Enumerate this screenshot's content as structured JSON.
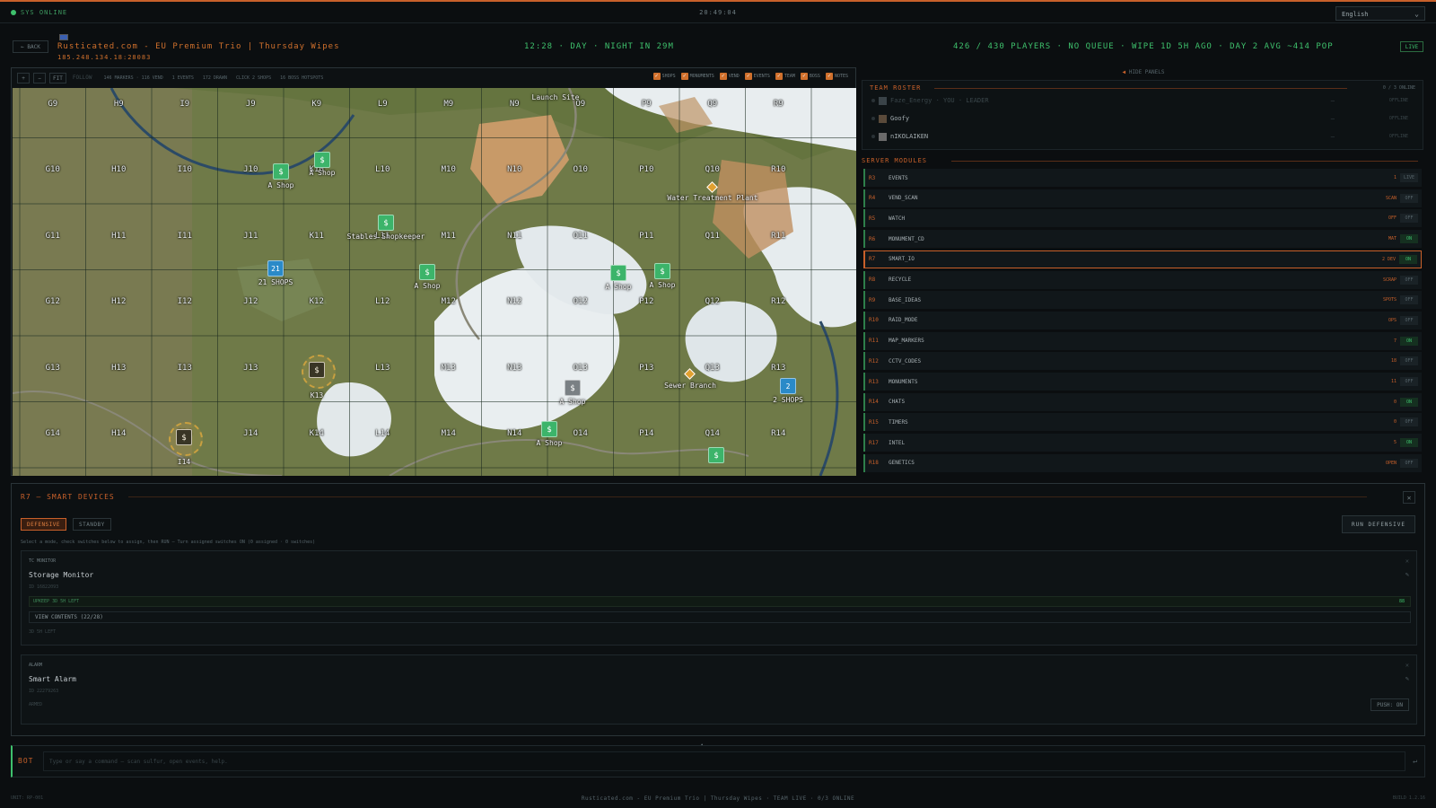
{
  "status": {
    "sys": "SYS ONLINE",
    "clock": "20:49:04",
    "language": "English"
  },
  "header": {
    "back": "← BACK",
    "server_name": "Rusticated.com - EU Premium Trio | Thursday Wipes",
    "server_ip": "185.248.134.18:28083",
    "daytime": "12:28 · DAY · NIGHT IN 29M",
    "players": "426 / 430 PLAYERS · NO QUEUE · WIPE 1D 5H AGO · DAY 2 AVG ~414 POP",
    "live": "LIVE"
  },
  "map": {
    "tools": [
      "+",
      "−",
      "FIT",
      "FOLLOW"
    ],
    "stats": [
      "146 MARKERS · 116 VEND",
      "1 EVENTS",
      "172 DRAWN",
      "CLICK 2 SHOPS",
      "16 BOSS HOTSPOTS"
    ],
    "filters": [
      "SHOPS",
      "MONUMENTS",
      "VEND",
      "EVENTS",
      "TEAM",
      "BOSS",
      "NOTES"
    ],
    "rows": [
      "9",
      "10",
      "11",
      "12",
      "13",
      "14"
    ],
    "cols": [
      "G",
      "H",
      "I",
      "J",
      "K",
      "L",
      "M",
      "N",
      "O",
      "P",
      "Q",
      "R"
    ],
    "labels": {
      "launch": "Launch Site",
      "water": "Water Treatment Plant",
      "stables": "Stables Shopkeeper",
      "sewer": "Sewer Branch",
      "shop": "A Shop",
      "shops21": "21 SHOPS",
      "shops2": "2 SHOPS",
      "k13": "K13",
      "i14": "I14"
    },
    "marker": {
      "dollar": "$",
      "n21": "21",
      "n2": "2"
    }
  },
  "roster": {
    "title": "TEAM ROSTER",
    "count": "0 / 3 ONLINE",
    "hide": "HIDE PANELS",
    "members": [
      {
        "name": "Faze_Energy · YOU · LEADER",
        "status": "OFFLINE"
      },
      {
        "name": "Goofy",
        "status": "OFFLINE"
      },
      {
        "name": "nIKOLAIKEN",
        "status": "OFFLINE"
      }
    ]
  },
  "modules": {
    "title": "SERVER MODULES",
    "items": [
      {
        "id": "R3",
        "name": "EVENTS",
        "val": "1",
        "tog": "LIVE"
      },
      {
        "id": "R4",
        "name": "VEND_SCAN",
        "val": "SCAN",
        "tog": "OFF"
      },
      {
        "id": "R5",
        "name": "WATCH",
        "val": "OFF",
        "tog": "OFF"
      },
      {
        "id": "R6",
        "name": "MONUMENT_CD",
        "val": "MAT",
        "tog": "ON"
      },
      {
        "id": "R7",
        "name": "SMART_IO",
        "val": "2 DEV",
        "tog": "ON"
      },
      {
        "id": "R8",
        "name": "RECYCLE",
        "val": "SCRAP",
        "tog": "OFF"
      },
      {
        "id": "R9",
        "name": "BASE_IDEAS",
        "val": "SPOTS",
        "tog": "OFF"
      },
      {
        "id": "R10",
        "name": "RAID_MODE",
        "val": "OPS",
        "tog": "OFF"
      },
      {
        "id": "R11",
        "name": "MAP_MARKERS",
        "val": "7",
        "tog": "ON"
      },
      {
        "id": "R12",
        "name": "CCTV_CODES",
        "val": "18",
        "tog": "OFF"
      },
      {
        "id": "R13",
        "name": "MONUMENTS",
        "val": "11",
        "tog": "OFF"
      },
      {
        "id": "R14",
        "name": "CHATS",
        "val": "0",
        "tog": "ON"
      },
      {
        "id": "R15",
        "name": "TIMERS",
        "val": "0",
        "tog": "OFF"
      },
      {
        "id": "R17",
        "name": "INTEL",
        "val": "5",
        "tog": "ON"
      },
      {
        "id": "R18",
        "name": "GENETICS",
        "val": "OPEN",
        "tog": "OFF"
      }
    ]
  },
  "devices": {
    "title": "R7 — SMART DEVICES",
    "close": "✕",
    "mode_defensive": "DEFENSIVE",
    "mode_standby": "STANDBY",
    "run": "RUN DEFENSIVE",
    "help": "Select a mode, check switches below to assign, then RUN — Turn assigned switches ON (0 assigned · 0 switches)",
    "tc": {
      "type": "TC MONITOR",
      "name": "Storage Monitor",
      "id": "ID 16822093",
      "upkeep": "UPKEEP 3D 5H LEFT",
      "upkeep_pct": "88",
      "view": "VIEW CONTENTS (22/28)",
      "decay": "3D 5H LEFT",
      "close": "✕",
      "edit": "✎"
    },
    "alarm": {
      "type": "ALARM",
      "name": "Smart Alarm",
      "id": "ID 22279263",
      "armed": "ARMED",
      "push": "PUSH: ON",
      "close": "✕",
      "edit": "✎"
    }
  },
  "bot": {
    "label": "BOT",
    "placeholder": "Type or say a command — scan sulfur, open events, help.",
    "send": "↵",
    "collapse": "▲"
  },
  "footer": {
    "left": "UNIT: RP-001",
    "center": "Rusticated.com - EU Premium Trio | Thursday Wipes · TEAM LIVE · 0/3 ONLINE",
    "right": "BUILD 1.2.16"
  }
}
